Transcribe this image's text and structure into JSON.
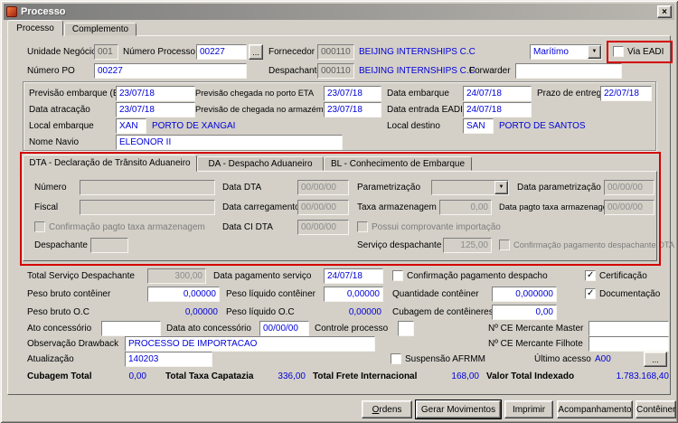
{
  "icons": {
    "close": "×",
    "check": "✓",
    "dropdown": "▼",
    "browse": "..."
  },
  "colors": {
    "accent_red": "#d40000",
    "value_blue": "#0000d8",
    "window_bg": "#d4d0c8"
  },
  "window": {
    "title": "Processo"
  },
  "tabs": {
    "processo": "Processo",
    "complemento": "Complemento"
  },
  "top": {
    "unidade_negocio": {
      "label": "Unidade Negócio",
      "value": "001"
    },
    "numero_processo": {
      "label": "Número Processo",
      "value": "00227"
    },
    "fornecedor": {
      "label": "Fornecedor",
      "code": "000110",
      "name": "BEIJING INTERNSHIPS C.C"
    },
    "modal": {
      "value": "Marítimo"
    },
    "via_eadi": {
      "label": "Via EADI",
      "checked": false
    },
    "numero_po": {
      "label": "Número PO",
      "value": "00227"
    },
    "despachante": {
      "label": "Despachante",
      "code": "000110",
      "name": "BEIJING INTERNSHIPS C.C"
    },
    "forwarder": {
      "label": "Forwarder",
      "value": ""
    }
  },
  "embarque": {
    "previsao_embarque_etd": {
      "label": "Previsão embarque (ETD)",
      "value": "23/07/18"
    },
    "previsao_chegada_porto_eta": {
      "label": "Previsão chegada no porto ETA",
      "value": "23/07/18"
    },
    "data_embarque": {
      "label": "Data embarque",
      "value": "24/07/18"
    },
    "prazo_entrega": {
      "label": "Prazo de entrega",
      "value": "22/07/18"
    },
    "data_atracacao": {
      "label": "Data atracação",
      "value": "23/07/18"
    },
    "previsao_chegada_armazem": {
      "label": "Previsão de chegada no armazém",
      "value": "23/07/18"
    },
    "data_entrada_eadi": {
      "label": "Data entrada EADI",
      "value": "24/07/18"
    },
    "local_embarque": {
      "label": "Local embarque",
      "code": "XAN",
      "name": "PORTO DE XANGAI"
    },
    "local_destino": {
      "label": "Local destino",
      "code": "SAN",
      "name": "PORTO DE SANTOS"
    },
    "nome_navio": {
      "label": "Nome Navio",
      "value": "ELEONOR II"
    }
  },
  "dta_section": {
    "tab_dta": "DTA - Declaração de Trânsito Aduaneiro",
    "tab_da": "DA - Despacho Aduaneiro",
    "tab_bl": "BL - Conhecimento de Embarque",
    "numero": {
      "label": "Número",
      "value": ""
    },
    "data_dta": {
      "label": "Data DTA",
      "value": "00/00/00"
    },
    "parametrizacao": {
      "label": "Parametrização",
      "value": ""
    },
    "data_parametrizacao": {
      "label": "Data parametrização",
      "value": "00/00/00"
    },
    "fiscal": {
      "label": "Fiscal",
      "value": ""
    },
    "data_carregamento": {
      "label": "Data carregamento",
      "value": "00/00/00"
    },
    "taxa_armazenagem": {
      "label": "Taxa armazenagem",
      "value": "0,00"
    },
    "data_pagto_taxa": {
      "label": "Data pagto taxa armazenagem",
      "value": "00/00/00"
    },
    "confirmacao_pagto_taxa": {
      "label": "Confirmação pagto taxa armazenagem",
      "checked": false
    },
    "data_ci_dta": {
      "label": "Data CI DTA",
      "value": "00/00/00"
    },
    "possui_comprovante": {
      "label": "Possui comprovante importação",
      "checked": false
    },
    "despachante": {
      "label": "Despachante",
      "value": ""
    },
    "servico_despachante": {
      "label": "Serviço despachante",
      "value": "125,00"
    },
    "confirmacao_pag_despachante": {
      "label": "Confirmação pagamento despachante DTA",
      "checked": false
    }
  },
  "bottom": {
    "total_servico_despachante": {
      "label": "Total Serviço Despachante",
      "value": "300,00"
    },
    "data_pagamento_servico": {
      "label": "Data pagamento serviço",
      "value": "24/07/18"
    },
    "confirmacao_pagamento_despacho": {
      "label": "Confirmação pagamento despacho",
      "checked": false
    },
    "certificacao": {
      "label": "Certificação",
      "checked": true
    },
    "peso_bruto_conteiner": {
      "label": "Peso bruto contêiner",
      "value": "0,00000"
    },
    "peso_liquido_conteiner": {
      "label": "Peso líquido contêiner",
      "value": "0,00000"
    },
    "quantidade_conteiner": {
      "label": "Quantidade contêiner",
      "value": "0,000000"
    },
    "documentacao": {
      "label": "Documentação",
      "checked": true
    },
    "peso_bruto_oc": {
      "label": "Peso bruto O.C",
      "value": "0,00000"
    },
    "peso_liquido_oc": {
      "label": "Peso líquido O.C",
      "value": "0,00000"
    },
    "cubagem_conteineres": {
      "label": "Cubagem de contêineres",
      "value": "0,00"
    },
    "ato_concessorio": {
      "label": "Ato concessório",
      "value": ""
    },
    "data_ato_concessorio": {
      "label": "Data ato concessório",
      "value": "00/00/00"
    },
    "controle_processo": {
      "label": "Controle processo",
      "value": ""
    },
    "ce_mercante_master": {
      "label": "Nº CE Mercante Master",
      "value": ""
    },
    "observacao_drawback": {
      "label": "Observação Drawback",
      "value": "PROCESSO DE IMPORTACAO"
    },
    "ce_mercante_filhote": {
      "label": "Nº CE Mercante Filhote",
      "value": ""
    },
    "atualizacao": {
      "label": "Atualização",
      "value": "140203"
    },
    "suspensao_afrmm": {
      "label": "Suspensão AFRMM",
      "checked": false
    },
    "ultimo_acesso": {
      "label": "Último acesso",
      "value": "A00"
    }
  },
  "totals": {
    "cubagem_total": {
      "label": "Cubagem Total",
      "value": "0,00"
    },
    "total_taxa_capatazia": {
      "label": "Total Taxa Capatazia",
      "value": "336,00"
    },
    "total_frete_internacional": {
      "label": "Total Frete Internacional",
      "value": "168,00"
    },
    "valor_total_indexado": {
      "label": "Valor Total Indexado",
      "value": "1.783.168,40"
    }
  },
  "buttons": {
    "ordens": "Ordens",
    "gerar_movimentos": "Gerar Movimentos",
    "imprimir": "Imprimir",
    "acompanhamento": "Acompanhamento",
    "conteiner": "Contêiner"
  }
}
